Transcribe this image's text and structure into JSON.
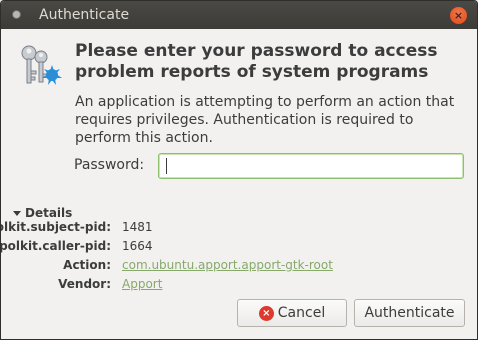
{
  "window": {
    "title": "Authenticate",
    "close_glyph": "×"
  },
  "message": {
    "heading": "Please enter your password to access problem reports of system programs",
    "description": "An application is attempting to perform an action that requires privileges. Authentication is required to perform this action."
  },
  "password": {
    "label": "Password:",
    "value": "",
    "placeholder": ""
  },
  "details": {
    "toggle_label": "Details",
    "rows": [
      {
        "key": "polkit.subject-pid:",
        "value": "1481"
      },
      {
        "key": "polkit.caller-pid:",
        "value": "1664"
      },
      {
        "key": "Action:",
        "value": "com.ubuntu.apport.apport-gtk-root"
      },
      {
        "key": "Vendor:",
        "value": "Apport"
      }
    ]
  },
  "buttons": {
    "cancel": "Cancel",
    "cancel_glyph": "×",
    "authenticate": "Authenticate"
  },
  "colors": {
    "accent": "#86a96a",
    "close": "#df4a16",
    "titlebar": "#3c3b37"
  }
}
